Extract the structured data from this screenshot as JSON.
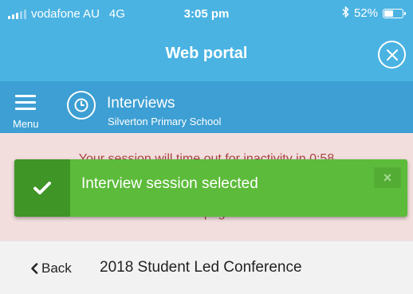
{
  "status_bar": {
    "carrier": "vodafone AU",
    "network": "4G",
    "time": "3:05 pm",
    "battery_percent": "52%",
    "battery_level": 0.52
  },
  "header": {
    "title": "Web portal",
    "close_icon": "close-circle-icon"
  },
  "nav": {
    "menu_label": "Menu",
    "section_icon": "clock-icon",
    "title": "Interviews",
    "subtitle": "Silverton Primary School"
  },
  "warning": {
    "line1": "Your session will time out for inactivity in 0:58",
    "line2": "this page"
  },
  "toast": {
    "message": "Interview session selected",
    "close_glyph": "×",
    "check_icon": "check-icon"
  },
  "page": {
    "back_label": "Back",
    "title": "2018 Student Led Conference"
  },
  "colors": {
    "primary": "#4ab3e2",
    "nav": "#3d9fd3",
    "success": "#5cbb3a",
    "success_dark": "#3f9526",
    "warning_bg": "#f2dedd",
    "warning_text": "#a94442"
  }
}
